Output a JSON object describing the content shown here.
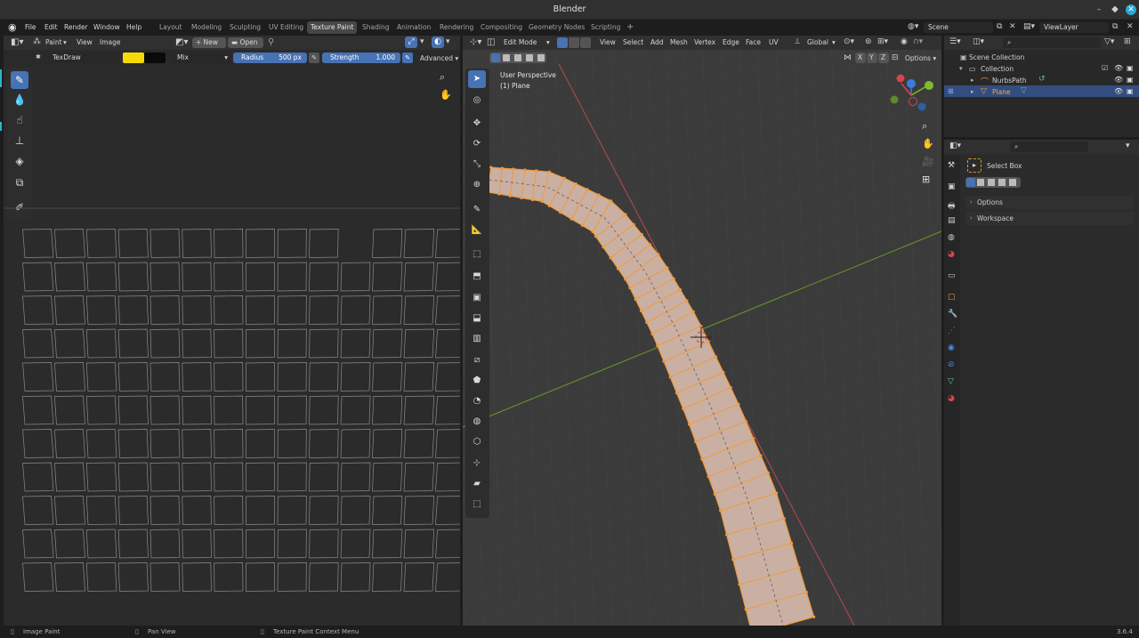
{
  "window": {
    "title": "Blender"
  },
  "menu": [
    "File",
    "Edit",
    "Render",
    "Window",
    "Help"
  ],
  "workspaces": [
    {
      "label": "Layout",
      "active": false
    },
    {
      "label": "Modeling",
      "active": false
    },
    {
      "label": "Sculpting",
      "active": false
    },
    {
      "label": "UV Editing",
      "active": false
    },
    {
      "label": "Texture Paint",
      "active": true
    },
    {
      "label": "Shading",
      "active": false
    },
    {
      "label": "Animation",
      "active": false
    },
    {
      "label": "Rendering",
      "active": false
    },
    {
      "label": "Compositing",
      "active": false
    },
    {
      "label": "Geometry Nodes",
      "active": false
    },
    {
      "label": "Scripting",
      "active": false
    }
  ],
  "scene": {
    "name": "Scene",
    "view_layer": "ViewLayer"
  },
  "image_editor": {
    "mode": "Paint",
    "menu_view": "View",
    "menu_image": "Image",
    "new_label": "New",
    "open_label": "Open",
    "brush": "TexDraw",
    "color_primary": "#f5d90a",
    "color_secondary": "#0a0a0a",
    "blend": "Mix",
    "radius_label": "Radius",
    "radius_value": "500 px",
    "strength_label": "Strength",
    "strength_value": "1.000",
    "advanced_label": "Advanced"
  },
  "viewport": {
    "mode": "Edit Mode",
    "menus": [
      "View",
      "Select",
      "Add",
      "Mesh",
      "Vertex",
      "Edge",
      "Face",
      "UV"
    ],
    "orientation": "Global",
    "axes": [
      "X",
      "Y",
      "Z"
    ],
    "options_label": "Options",
    "overlay_line1": "User Perspective",
    "overlay_line2": "(1) Plane"
  },
  "outliner": {
    "root": "Scene Collection",
    "collection": "Collection",
    "items": [
      {
        "label": "NurbsPath",
        "selected": false
      },
      {
        "label": "Plane",
        "selected": true
      }
    ]
  },
  "properties": {
    "tool": "Select Box",
    "sections": [
      "Options",
      "Workspace"
    ]
  },
  "status": {
    "item1": "Image Paint",
    "item2": "Pan View",
    "item3": "Texture Paint Context Menu",
    "version": "3.6.4"
  },
  "colors": {
    "accent": "#4772b3",
    "orange": "#f09a3c",
    "x_axis": "#d8434f",
    "y_axis": "#7fbb2a",
    "z_axis": "#3a7bdf"
  }
}
